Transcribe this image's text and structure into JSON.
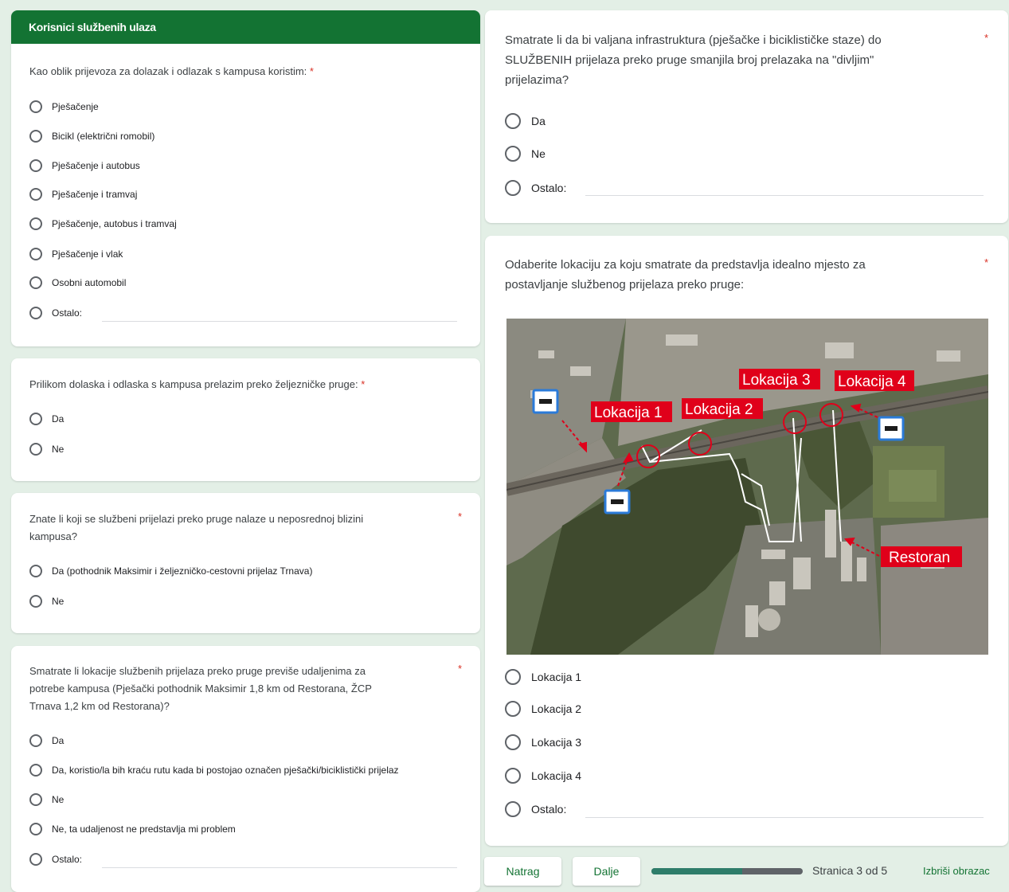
{
  "section": {
    "title": "Korisnici službenih ulaza"
  },
  "q1": {
    "text": "Kao oblik prijevoza za dolazak i odlazak s kampusa koristim:",
    "required": "*",
    "options": [
      "Pješačenje",
      "Bicikl (električni romobil)",
      "Pješačenje i autobus",
      "Pješačenje i tramvaj",
      "Pješačenje, autobus i tramvaj",
      "Pješačenje i vlak",
      "Osobni automobil",
      "Ostalo:"
    ]
  },
  "q2": {
    "text": "Prilikom dolaska i odlaska s kampusa prelazim preko željezničke pruge:",
    "required": "*",
    "options": [
      "Da",
      "Ne"
    ]
  },
  "q3": {
    "text_line1": "Znate li koji se službeni prijelazi preko pruge nalaze u neposrednoj blizini",
    "text_line2": "kampusa?",
    "required": "*",
    "options": [
      "Da (pothodnik Maksimir i željezničko-cestovni prijelaz Trnava)",
      "Ne"
    ]
  },
  "q4": {
    "text_line1": "Smatrate li lokacije službenih prijelaza preko pruge previše udaljenima za",
    "text_line2": "potrebe kampusa (Pješački pothodnik Maksimir 1,8 km od Restorana, ŽCP",
    "text_line3": "Trnava 1,2 km od Restorana)?",
    "required": "*",
    "options": [
      "Da",
      "Da, koristio/la bih kraću rutu kada bi postojao označen pješački/biciklistički prijelaz",
      "Ne",
      "Ne, ta udaljenost ne predstavlja mi problem",
      "Ostalo:"
    ]
  },
  "q5": {
    "text_line1": "Smatrate li da bi valjana infrastruktura (pješačke i biciklističke staze) do",
    "text_line2": "SLUŽBENIH  prijelaza preko pruge smanjila broj prelazaka na \"divljim\"",
    "text_line3": "prijelazima?",
    "required": "*",
    "options": [
      "Da",
      "Ne",
      "Ostalo:"
    ]
  },
  "q6": {
    "text_line1": "Odaberite lokaciju za koju smatrate da predstavlja idealno mjesto za",
    "text_line2": "postavljanje službenog prijelaza preko pruge:",
    "required": "*",
    "map_labels": [
      "Lokacija 1",
      "Lokacija 2",
      "Lokacija 3",
      "Lokacija 4",
      "Restoran"
    ],
    "options": [
      "Lokacija 1",
      "Lokacija 2",
      "Lokacija 3",
      "Lokacija 4",
      "Ostalo:"
    ]
  },
  "footer": {
    "back": "Natrag",
    "next": "Dalje",
    "progress": 0.6,
    "page": "Stranica 3 od 5",
    "clear": "Izbriši obrazac"
  },
  "colors": {
    "accent": "#137333",
    "background": "#e3efe6",
    "required": "#d93025",
    "map_label": "#e0001a"
  }
}
